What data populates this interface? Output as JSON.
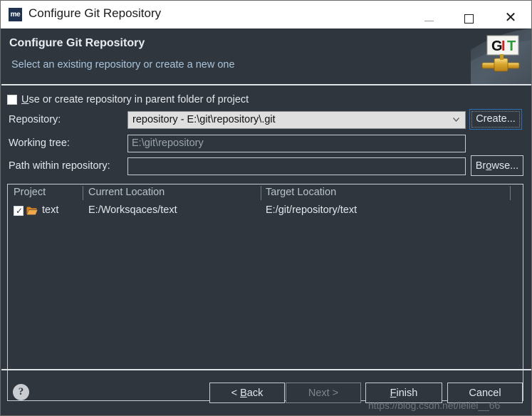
{
  "window": {
    "title": "Configure Git Repository",
    "app_icon_text": "me",
    "controls": {
      "minimize": "–",
      "maximize": "□",
      "close": "✕"
    }
  },
  "header": {
    "title": "Configure Git Repository",
    "subtitle": "Select an existing repository or create a new one",
    "logo": {
      "g": "G",
      "i": "I",
      "t": "T",
      "g_color": "#111111",
      "i_color": "#cc2222",
      "t_color": "#2a9a3a"
    }
  },
  "form": {
    "parent_checkbox": {
      "label_prefix": "",
      "mnemonic": "U",
      "label_rest": "se or create repository in parent folder of project",
      "checked": false
    },
    "repository": {
      "label": "Repository:",
      "value": "repository - E:\\git\\repository\\.git",
      "create_button": "Create...",
      "create_button_focused": true
    },
    "working_tree": {
      "label": "Working tree:",
      "value": "E:\\git\\repository"
    },
    "path_within": {
      "label": "Path within repository:",
      "value": "",
      "browse_button_prefix": "Br",
      "browse_button_mnemonic": "o",
      "browse_button_rest": "wse..."
    }
  },
  "table": {
    "columns": [
      "Project",
      "Current Location",
      "Target Location",
      ""
    ],
    "rows": [
      {
        "checked": true,
        "project": "text",
        "current_location": "E:/Worksqaces/text",
        "target_location": "E:/git/repository/text"
      }
    ]
  },
  "footer": {
    "help": "?",
    "back": {
      "prefix": "< ",
      "mnemonic": "B",
      "rest": "ack",
      "enabled": true
    },
    "next": {
      "prefix": "",
      "mnemonic": "",
      "rest": "Next >",
      "enabled": false
    },
    "finish": {
      "prefix": "",
      "mnemonic": "F",
      "rest": "inish",
      "enabled": true
    },
    "cancel": {
      "prefix": "",
      "mnemonic": "",
      "rest": "Cancel",
      "enabled": true
    },
    "watermark": "https://blog.csdn.net/leilei__66"
  },
  "colors": {
    "background": "#2f363d",
    "titlebar": "#ffffff",
    "accent_focus": "#2a6fb8",
    "subtitle": "#a9c4dc",
    "folder_icon": "#e08a2e"
  }
}
